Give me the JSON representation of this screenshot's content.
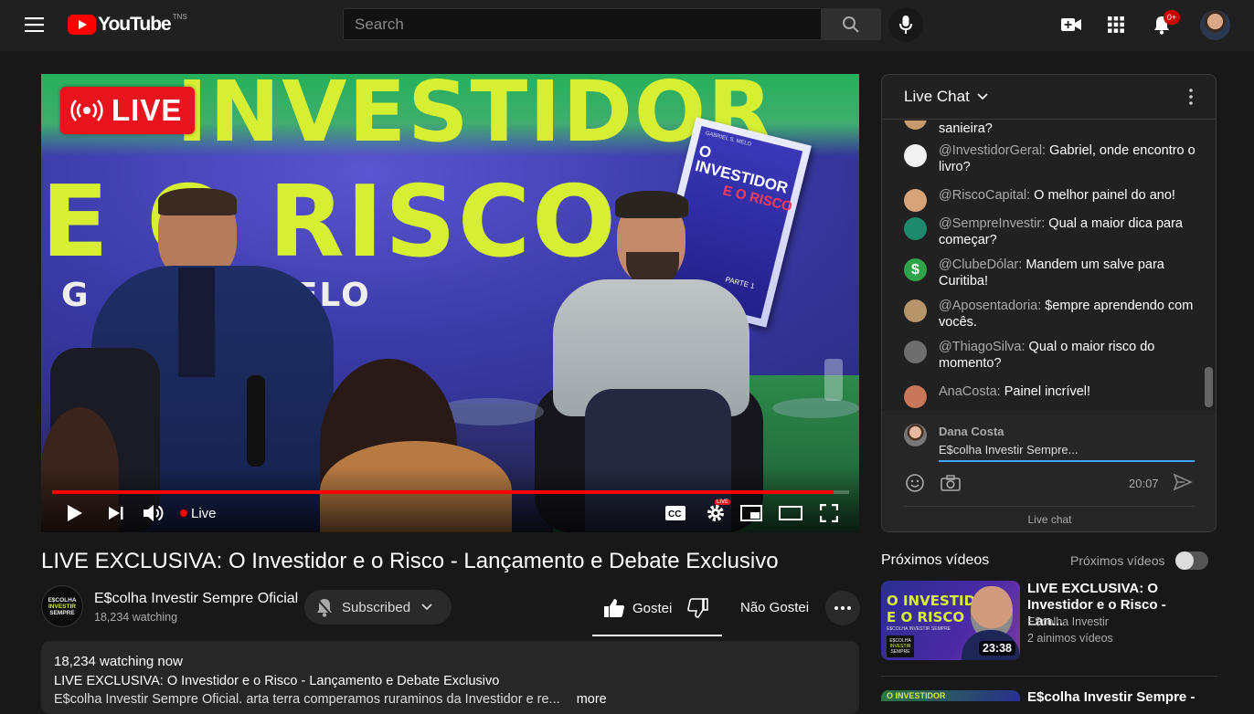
{
  "header": {
    "logo_text": "YouTube",
    "logo_region": "TNS",
    "search_placeholder": "Search",
    "notification_count": "0+",
    "brand_red": "#ff0000"
  },
  "video": {
    "live_badge": "LIVE",
    "backdrop_line1": "INVESTIDOR",
    "backdrop_line2": "E O RISCO",
    "backdrop_name_left": "G",
    "backdrop_name_right": "MELO",
    "book_author": "GABRIEL S. MELO",
    "book_title1": "O INVESTIDOR",
    "book_title2": "E O RISCO",
    "book_footer": "PARTE 1",
    "controls": {
      "live_label": "Live",
      "settings_badge": "LIVE",
      "progress": 0.98
    }
  },
  "chat": {
    "title": "Live Chat",
    "messages": [
      {
        "author": "",
        "text": "sanieira?",
        "avatar_color": "#c79a6c"
      },
      {
        "author": "@InvestidorGeral:",
        "text": " Gabriel, onde encontro o livro?",
        "avatar_color": "#f2f2f2"
      },
      {
        "author": "@RiscoCapital:",
        "text": " O melhor painel do ano!",
        "avatar_color": "#d7a47a"
      },
      {
        "author": "@SempreInvestir:",
        "text": " Qual a maior dica para começar?",
        "avatar_color": "#1e8a6c"
      },
      {
        "author": "@ClubeDólar:",
        "text": " Mandem um salve para Curitiba!",
        "avatar_color": "#2fa34a"
      },
      {
        "author": "@Aposentadoria:",
        "text": " $empre aprendendo com vocês.",
        "avatar_color": "#b7946a"
      },
      {
        "author": "@ThiagoSilva:",
        "text": " Qual o maior risco do momento?",
        "avatar_color": "#6e6e6e"
      },
      {
        "author": "AnaCosta:",
        "text": "  Painel incrível!",
        "avatar_color": "#c9775a"
      }
    ],
    "composer": {
      "name": "Dana Costa",
      "value": "E$colha Investir Sempre...",
      "time": "20:07"
    },
    "footer": "Live chat"
  },
  "below": {
    "title": "LIVE EXCLUSIVA: O Investidor e o Risco - Lançamento e Debate Exclusivo",
    "channel_name": "E$colha Investir Sempre Oficial",
    "channel_sub": "18,234 watching",
    "channel_logo_lines": [
      "E$COLHA",
      "INVESTIR",
      "SEMPRE"
    ],
    "subscribed_label": "Subscribed",
    "like_label": "Gostei",
    "dislike_label": "Não Gostei"
  },
  "description": {
    "watching": "18,234 watching now",
    "line1": "LIVE EXCLUSIVA: O Investidor e o Risco - Lançamento e Debate Exclusivo",
    "line2": "E$colha Investir Sempre Oficial. arta terra comperamos ruraminos da Investidor e re...",
    "more": "more"
  },
  "sidebar": {
    "heading": "Próximos vídeos",
    "autoplay_label": "Próximos vídeos",
    "items": [
      {
        "thumb_line1": "O INVESTIDOR",
        "thumb_line2": "E O RISCO",
        "thumb_sub": "E$COLHA INVESTIR SEMPRE",
        "thumb_logo_lines": [
          "E$COLHA",
          "INVESTIR",
          "SEMPRE"
        ],
        "duration": "23:38",
        "title": "LIVE EXCLUSIVA: O Investidor e o Risco - Lan...",
        "channel": "E$colha Investir",
        "meta": "2 ainimos vídeos"
      },
      {
        "thumb_line1": "O INVESTIDOR",
        "title": "E$colha Investir Sempre -"
      }
    ]
  }
}
